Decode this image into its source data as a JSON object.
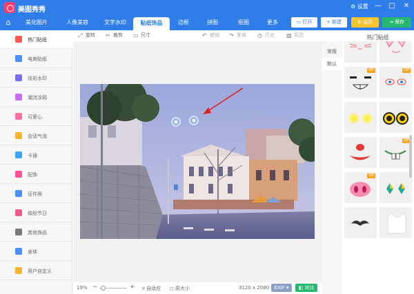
{
  "app": {
    "title": "美图秀秀",
    "settings": "设置"
  },
  "window_controls": [
    "—",
    "□",
    "✕"
  ],
  "nav": {
    "tabs": [
      "美化图片",
      "人像美容",
      "文字水印",
      "贴纸饰品",
      "边框",
      "拼图",
      "抠图",
      "更多"
    ],
    "active_index": 3,
    "buttons": {
      "open": "打开",
      "new": "新建",
      "vip": "会员",
      "save": "保存"
    }
  },
  "sidebar": {
    "items": [
      {
        "label": "热门贴纸",
        "icon": "fire-icon",
        "color": "#ff5a4e"
      },
      {
        "label": "电商贴纸",
        "icon": "cart-icon",
        "color": "#4a8ff7"
      },
      {
        "label": "炫彩水印",
        "icon": "watermark-icon",
        "color": "#7a6ff0"
      },
      {
        "label": "潮流涂鸦",
        "icon": "graffiti-icon",
        "color": "#c86df2"
      },
      {
        "label": "可爱心",
        "icon": "heart-icon",
        "color": "#ff6f9c"
      },
      {
        "label": "会话气泡",
        "icon": "bubble-icon",
        "color": "#f7b32b"
      },
      {
        "label": "卡通",
        "icon": "bear-icon",
        "color": "#3ba6f5"
      },
      {
        "label": "配饰",
        "icon": "bow-icon",
        "color": "#ff4f9a"
      },
      {
        "label": "证件照",
        "icon": "id-photo-icon",
        "color": "#4a8ff7"
      },
      {
        "label": "缤纷节日",
        "icon": "balloon-icon",
        "color": "#f25b8d"
      },
      {
        "label": "其他饰品",
        "icon": "grid-icon",
        "color": "#7a7a7a"
      },
      {
        "label": "身体",
        "icon": "person-icon",
        "color": "#4a8ff7"
      },
      {
        "label": "用户自定义",
        "icon": "pencil-icon",
        "color": "#f7b32b"
      }
    ],
    "active_index": 0
  },
  "toolbar": {
    "rotate": "旋转",
    "crop": "裁剪",
    "size": "尺寸",
    "undo": "撤销",
    "redo": "重做",
    "history": "历史",
    "original": "原图"
  },
  "bottom": {
    "zoom": "19%",
    "minus": "−",
    "plus": "+",
    "fit": "自适应",
    "original_size": "原大小",
    "dimensions": "3120 x 2080",
    "exif": "EXIF",
    "compare": "对比"
  },
  "right_panel": {
    "title": "热门贴纸",
    "categories": [
      "常用",
      "默认"
    ],
    "active_category": 1,
    "vip_label": "VIP",
    "stickers": [
      {
        "name": "cat-whiskers-sticker",
        "vip": false
      },
      {
        "name": "pink-ears-sticker",
        "vip": false
      },
      {
        "name": "toothy-grin-sticker",
        "vip": true
      },
      {
        "name": "teary-eyes-sticker",
        "vip": true
      },
      {
        "name": "glowing-eyes-sticker",
        "vip": false
      },
      {
        "name": "round-glasses-sticker",
        "vip": false
      },
      {
        "name": "clown-mouth-sticker",
        "vip": false
      },
      {
        "name": "buck-teeth-sticker",
        "vip": true
      },
      {
        "name": "pig-nose-sticker",
        "vip": true
      },
      {
        "name": "diamond-cheeks-sticker",
        "vip": false
      },
      {
        "name": "mustache-sticker",
        "vip": false
      },
      {
        "name": "white-cat-sticker",
        "vip": false
      }
    ]
  },
  "colors": {
    "accent": "#2f7de9",
    "green": "#26b871",
    "vip": "#f7c431",
    "red_arrow": "#e02020"
  }
}
